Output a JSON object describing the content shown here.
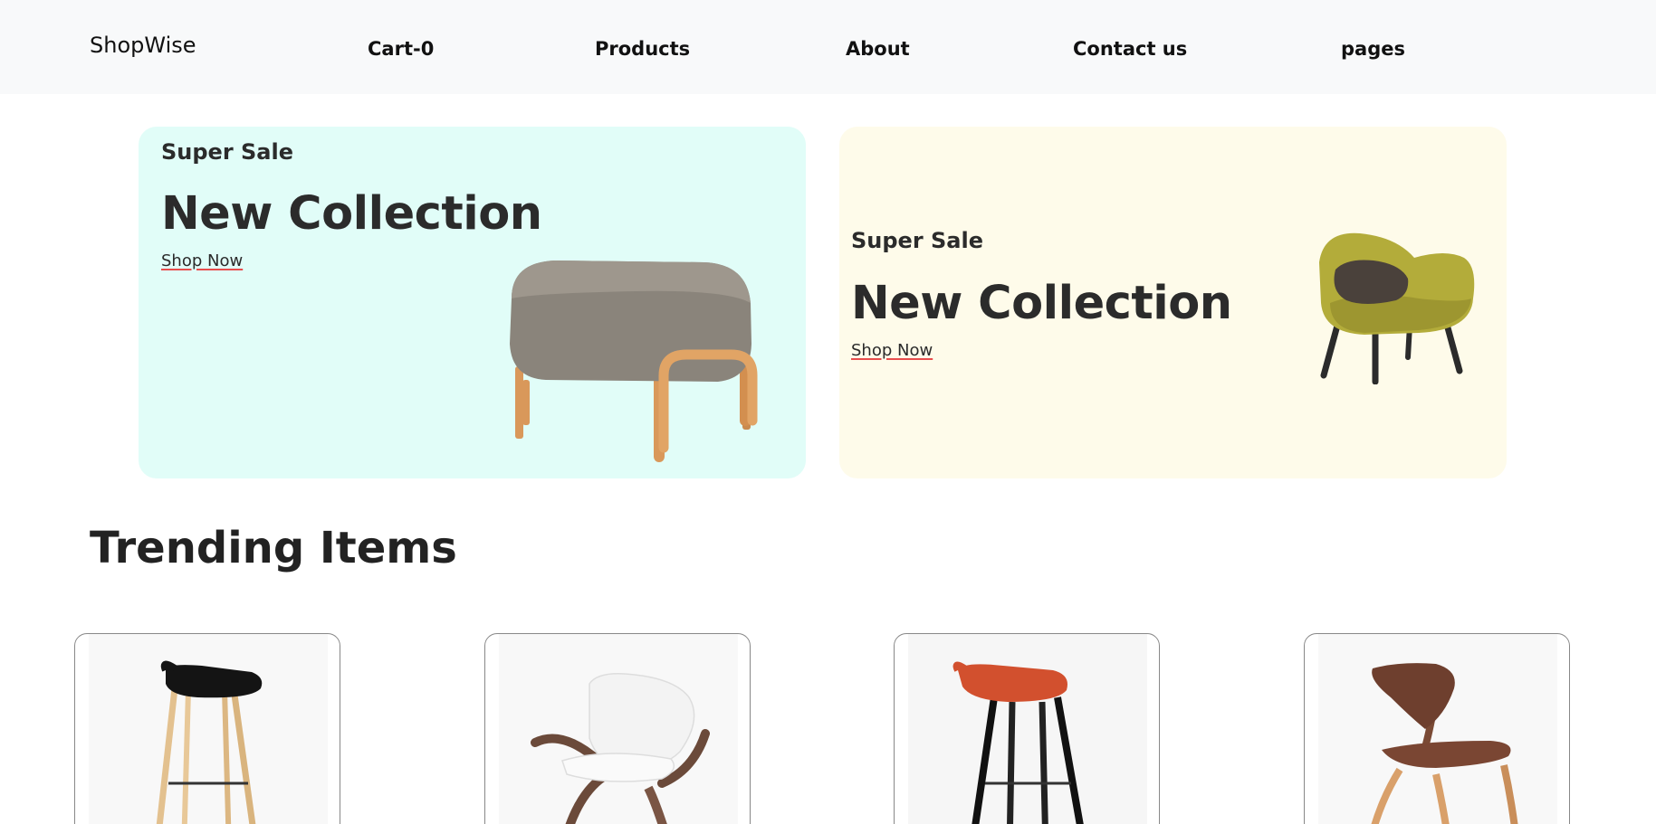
{
  "header": {
    "brand": "ShopWise",
    "nav": [
      "Cart-0",
      "Products",
      "About",
      "Contact us",
      "pages"
    ]
  },
  "hero": {
    "banners": [
      {
        "sale": "Super Sale",
        "title": "New Collection",
        "cta": "Shop Now",
        "background": "#e1fdf8",
        "product": "ottoman-image"
      },
      {
        "sale": "Super Sale",
        "title": "New Collection",
        "cta": "Shop Now",
        "background": "#fefbea",
        "product": "armchair-image"
      }
    ]
  },
  "trending": {
    "title": "Trending Items",
    "items": [
      {
        "product": "black-bar-stool-image"
      },
      {
        "product": "white-shell-chair-image"
      },
      {
        "product": "orange-bar-stool-image"
      },
      {
        "product": "walnut-chair-image"
      }
    ]
  },
  "colors": {
    "accent_underline": "#e84d4d",
    "navbar_bg": "#f8f9fa"
  }
}
